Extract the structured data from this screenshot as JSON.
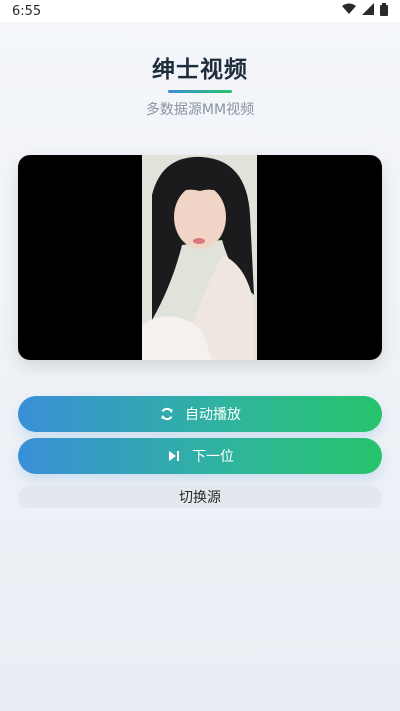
{
  "status": {
    "time": "6:55"
  },
  "header": {
    "title": "绅士视频",
    "subtitle": "多数据源MM视频"
  },
  "player": {
    "frame_color": "#000000"
  },
  "controls": {
    "autoplay_label": "自动播放",
    "next_label": "下一位",
    "switch_source_label": "切换源"
  },
  "colors": {
    "accent_start": "#3a8fd8",
    "accent_end": "#27c46b"
  },
  "icons": {
    "autoplay": "refresh-icon",
    "next": "skip-next-icon",
    "wifi": "wifi-icon",
    "signal": "signal-icon",
    "battery": "battery-icon"
  }
}
